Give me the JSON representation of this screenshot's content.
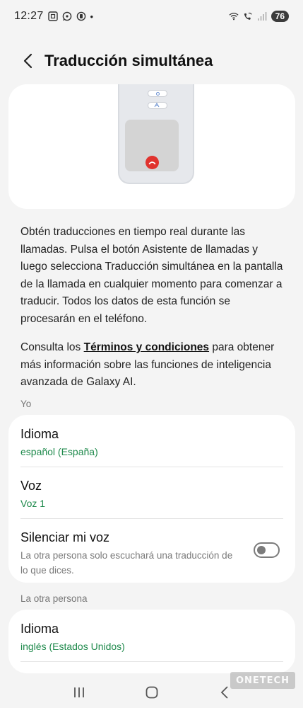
{
  "status_bar": {
    "time": "12:27",
    "dot": "•",
    "battery": "76",
    "icons_left": [
      "screenshot-icon",
      "whatsapp-icon",
      "record-icon"
    ],
    "icons_right": [
      "wifi-icon",
      "wifi-call-icon",
      "signal-icon"
    ]
  },
  "header": {
    "title": "Traducción simultánea"
  },
  "description": {
    "paragraph1": "Obtén traducciones en tiempo real durante las llamadas. Pulsa el botón Asistente de llamadas y luego selecciona Traducción simultánea en la pantalla de la llamada en cualquier momento para comenzar a traducir. Todos los datos de esta función se procesarán en el teléfono.",
    "paragraph2_pre": "Consulta los ",
    "paragraph2_link": "Términos y condiciones",
    "paragraph2_post": " para obtener más información sobre las funciones de inteligencia avanzada de Galaxy AI."
  },
  "section_me": {
    "label": "Yo",
    "language_title": "Idioma",
    "language_value": "español (España)",
    "voice_title": "Voz",
    "voice_value": "Voz 1",
    "mute_title": "Silenciar mi voz",
    "mute_desc": "La otra persona solo escuchará una traducción de lo que dices.",
    "mute_enabled": false
  },
  "section_other": {
    "label": "La otra persona",
    "language_title": "Idioma",
    "language_value": "inglés (Estados Unidos)"
  },
  "watermark": "ONETECH",
  "colors": {
    "accent_green": "#1f8a4c",
    "background": "#f4f4f4",
    "card": "#ffffff",
    "end_call_red": "#e0332e"
  }
}
